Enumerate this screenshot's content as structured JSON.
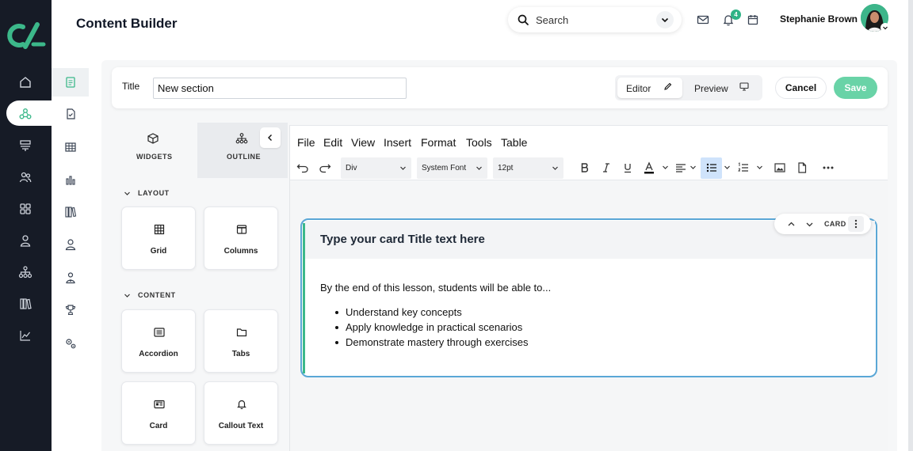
{
  "app": {
    "page_title": "Content Builder",
    "brand_color": "#3cb88a",
    "rail_color": "#161b26"
  },
  "rail": {
    "items": [
      "home-icon",
      "nodes-icon",
      "stack-icon",
      "users-icon",
      "grid-icon",
      "user-icon",
      "hierarchy-icon",
      "library-icon",
      "trend-icon"
    ],
    "active": "nodes-icon"
  },
  "subnav": {
    "items": [
      "page-icon",
      "document-check-icon",
      "table-icon",
      "bar-chart-icon",
      "books-icon",
      "person-icon",
      "person-tie-icon",
      "trophy-icon",
      "cogs-icon"
    ],
    "active": "page-icon"
  },
  "header": {
    "search_placeholder": "Search",
    "notification_count": "4",
    "user_name": "Stephanie Brown"
  },
  "titlebar": {
    "label": "Title",
    "value": "New section",
    "editor_label": "Editor",
    "preview_label": "Preview",
    "cancel_label": "Cancel",
    "save_label": "Save"
  },
  "widgets": {
    "tabs": [
      "WIDGETS",
      "OUTLINE"
    ],
    "sections": [
      {
        "title": "LAYOUT",
        "items": [
          "Grid",
          "Columns"
        ]
      },
      {
        "title": "CONTENT",
        "items": [
          "Accordion",
          "Tabs",
          "Card",
          "Callout Text"
        ]
      }
    ]
  },
  "editor": {
    "menus": [
      "File",
      "Edit",
      "View",
      "Insert",
      "Format",
      "Tools",
      "Table"
    ],
    "block_format": "Div",
    "font_family": "System Font",
    "font_size": "12pt"
  },
  "card": {
    "tools_label": "CARD",
    "title_placeholder": "Type your card Title text here",
    "intro": "By the end of this lesson, students will be able to...",
    "bullets": [
      "Understand key concepts",
      "Apply knowledge in practical scenarios",
      "Demonstrate mastery through exercises"
    ]
  }
}
